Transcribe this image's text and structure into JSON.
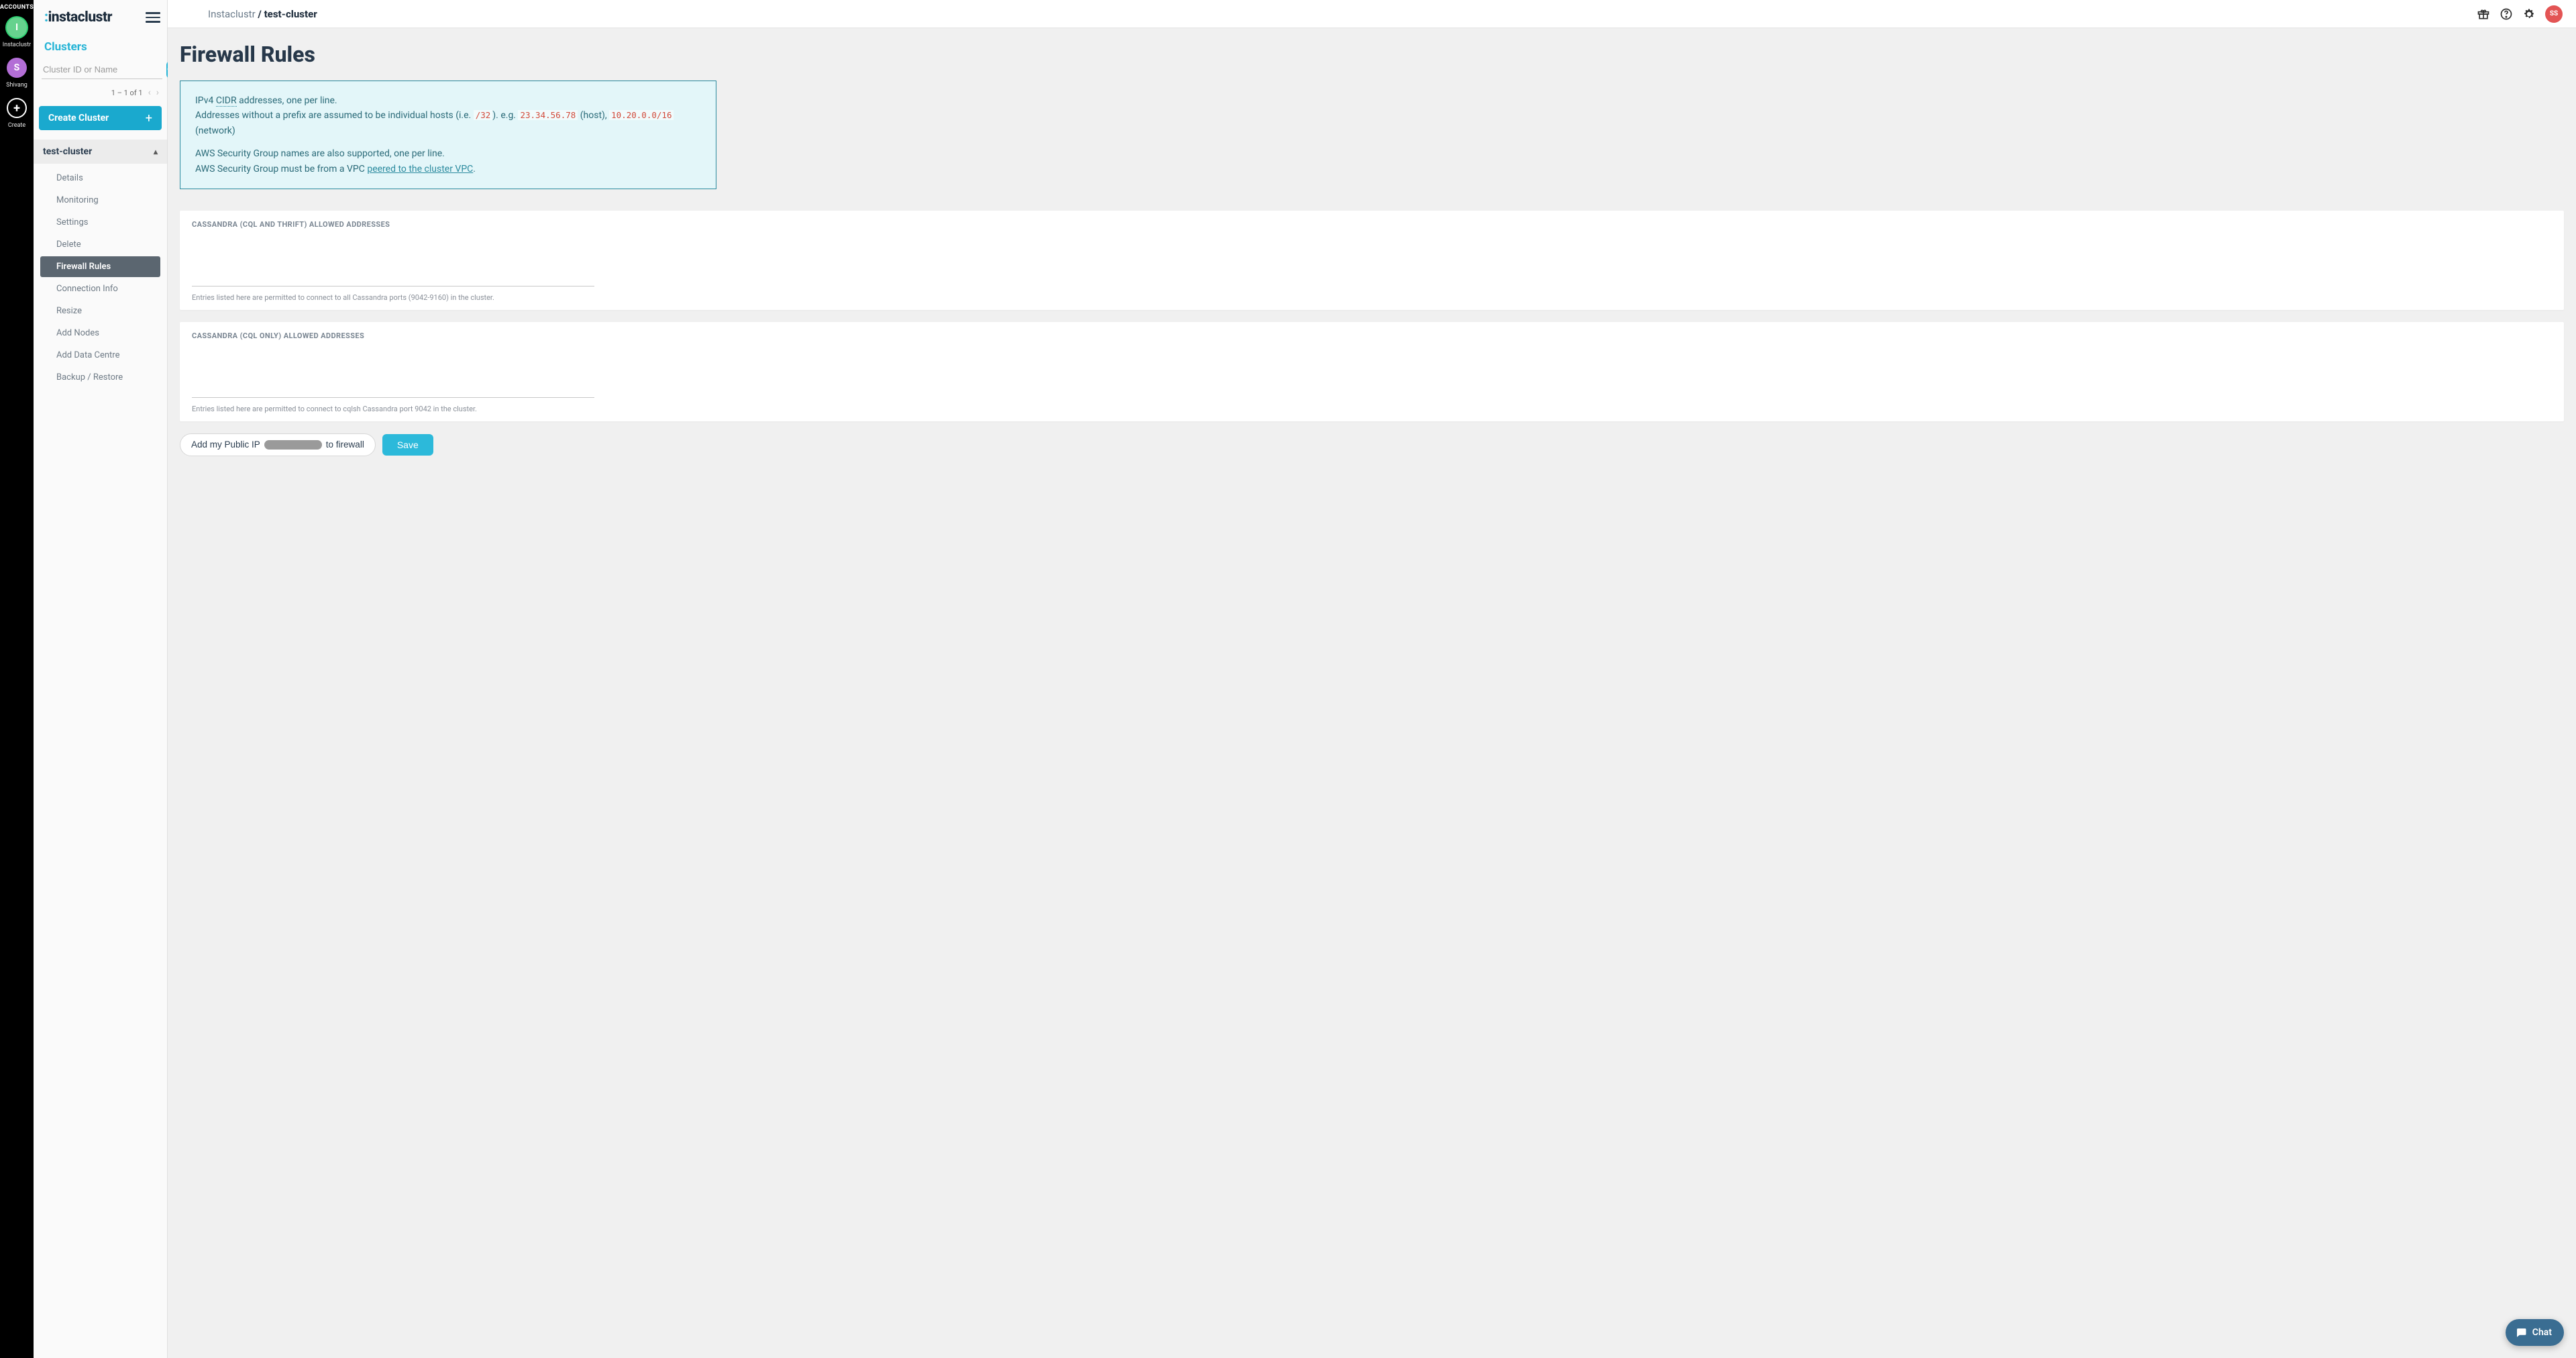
{
  "accounts_rail": {
    "title": "ACCOUNTS",
    "items": [
      {
        "initial": "I",
        "label": "Instaclustr",
        "color": "green"
      },
      {
        "initial": "S",
        "label": "Shivang",
        "color": "purple"
      }
    ],
    "create_label": "Create"
  },
  "brand": {
    "prefix_char": ":",
    "text_before": "",
    "text": "instaclustr"
  },
  "sidebar": {
    "clusters_heading": "Clusters",
    "search_placeholder": "Cluster ID or Name",
    "pager_text": "1 – 1 of 1",
    "create_button": "Create Cluster",
    "cluster_name": "test-cluster",
    "items": [
      {
        "label": "Details"
      },
      {
        "label": "Monitoring"
      },
      {
        "label": "Settings"
      },
      {
        "label": "Delete"
      },
      {
        "label": "Firewall Rules",
        "active": true
      },
      {
        "label": "Connection Info"
      },
      {
        "label": "Resize"
      },
      {
        "label": "Add Nodes"
      },
      {
        "label": "Add Data Centre"
      },
      {
        "label": "Backup / Restore"
      }
    ]
  },
  "topbar": {
    "crumb_root": "Instaclustr",
    "crumb_sep": " / ",
    "crumb_current": "test-cluster",
    "avatar_text": "SS"
  },
  "page": {
    "title": "Firewall Rules",
    "info_l1_a": "IPv4 ",
    "info_l1_cidr": "CIDR",
    "info_l1_b": " addresses, one per line.",
    "info_l2_a": "Addresses without a prefix are assumed to be individual hosts (i.e. ",
    "info_l2_code1": "/32",
    "info_l2_b": "). e.g. ",
    "info_l2_code2": "23.34.56.78",
    "info_l2_c": " (host), ",
    "info_l2_code3": "10.20.0.0/16",
    "info_l2_d": " (network)",
    "info_l3": "AWS Security Group names are also supported, one per line.",
    "info_l4_a": "AWS Security Group must be from a VPC ",
    "info_l4_link": "peered to the cluster VPC",
    "info_l4_b": ".",
    "card1_label": "CASSANDRA (CQL AND THRIFT) ALLOWED ADDRESSES",
    "card1_help": "Entries listed here are permitted to connect to all Cassandra ports (9042-9160) in the cluster.",
    "card2_label": "CASSANDRA (CQL ONLY) ALLOWED ADDRESSES",
    "card2_help": "Entries listed here are permitted to connect to cqlsh Cassandra port 9042 in the cluster.",
    "public_ip_prefix": "Add my Public IP ",
    "public_ip_suffix": " to firewall",
    "save_label": "Save"
  },
  "chat": {
    "label": "Chat"
  }
}
